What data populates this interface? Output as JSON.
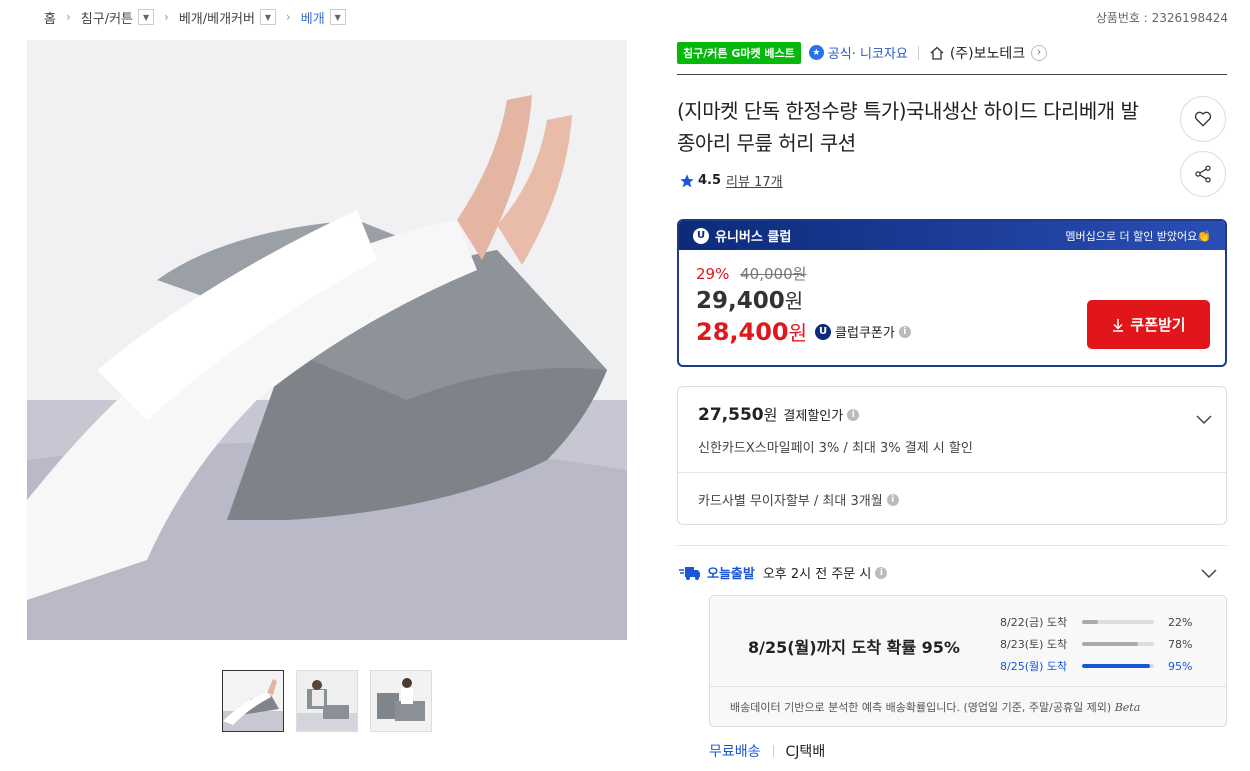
{
  "breadcrumb": {
    "home": "홈",
    "level1": "침구/커튼",
    "level2": "베개/베개커버",
    "level3": "베개"
  },
  "product_number": "상품번호 : 2326198424",
  "badges": {
    "best": "침구/커튼 G마켓 베스트",
    "official": "공식",
    "official_sub": "· 니코자요",
    "shop": "(주)보노테크"
  },
  "title": "(지마켓 단독 한정수량 특가)국내생산 하이드 다리베개 발 종아리 무릎 허리 쿠션",
  "rating": {
    "score": "4.5",
    "reviews": "리뷰 17개"
  },
  "membership": {
    "name": "유니버스 클럽",
    "message": "멤버십으로 더 할인 받았어요👏",
    "discount_pct": "29%",
    "original_price": "40,000원",
    "sale_amount": "29,400",
    "won": "원",
    "club_amount": "28,400",
    "club_label": "클럽쿠폰가",
    "coupon_button": "쿠폰받기"
  },
  "payment": {
    "amount": "27,550",
    "won": "원",
    "label": "결제할인가",
    "card_detail": "신한카드X스마일페이 3% / 최대 3% 결제 시 할인",
    "installment": "카드사별 무이자할부 / 최대 3개월"
  },
  "shipping": {
    "today_label": "오늘출발",
    "cutoff": "오후 2시 전 주문 시",
    "estimate": "8/25(월)까지 도착 확률 95%",
    "rows": [
      {
        "label": "8/22(금) 도착",
        "pct": "22%",
        "value": 22
      },
      {
        "label": "8/23(토) 도착",
        "pct": "78%",
        "value": 78
      },
      {
        "label": "8/25(월) 도착",
        "pct": "95%",
        "value": 95
      }
    ],
    "note": "배송데이터 기반으로 분석한 예측 배송확률입니다. (영업일 기준, 주말/공휴일 제외)",
    "beta": "Beta",
    "free": "무료배송",
    "carrier": "CJ택배"
  },
  "colors": {
    "accent_blue": "#1a57d6",
    "price_red": "#e0171c",
    "best_green": "#06b80b",
    "club_navy": "#0c2b7a"
  }
}
